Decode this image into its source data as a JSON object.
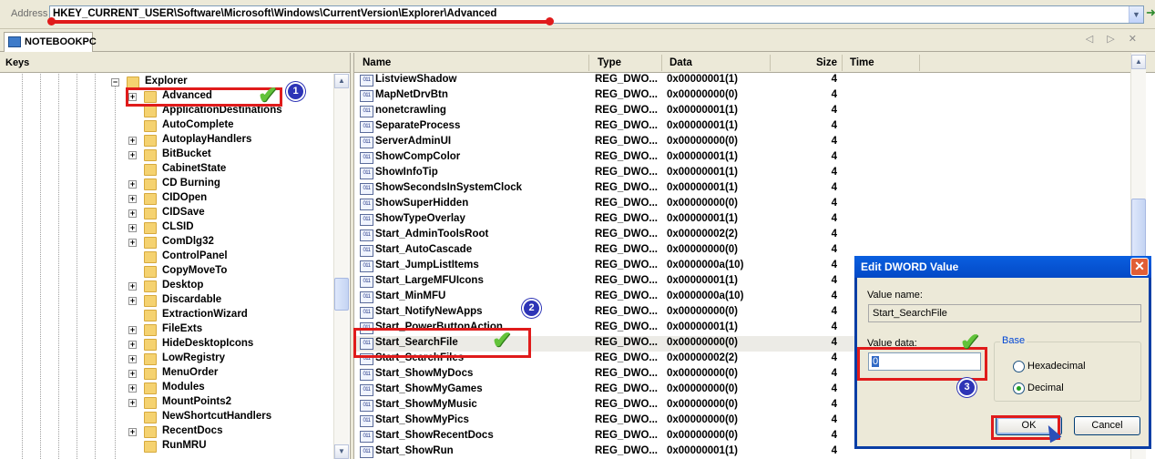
{
  "address": {
    "label": "Address",
    "value": "HKEY_CURRENT_USER\\Software\\Microsoft\\Windows\\CurrentVersion\\Explorer\\Advanced"
  },
  "tab": {
    "label": "NOTEBOOKPC",
    "controls": "◁ ▷ ✕"
  },
  "keys_pane": {
    "title": "Keys",
    "items": [
      {
        "label": "Explorer",
        "level": 0,
        "expander": "−"
      },
      {
        "label": "Advanced",
        "level": 1,
        "expander": "+"
      },
      {
        "label": "ApplicationDestinations",
        "level": 1,
        "expander": ""
      },
      {
        "label": "AutoComplete",
        "level": 1,
        "expander": ""
      },
      {
        "label": "AutoplayHandlers",
        "level": 1,
        "expander": "+"
      },
      {
        "label": "BitBucket",
        "level": 1,
        "expander": "+"
      },
      {
        "label": "CabinetState",
        "level": 1,
        "expander": ""
      },
      {
        "label": "CD Burning",
        "level": 1,
        "expander": "+"
      },
      {
        "label": "CIDOpen",
        "level": 1,
        "expander": "+"
      },
      {
        "label": "CIDSave",
        "level": 1,
        "expander": "+"
      },
      {
        "label": "CLSID",
        "level": 1,
        "expander": "+"
      },
      {
        "label": "ComDlg32",
        "level": 1,
        "expander": "+"
      },
      {
        "label": "ControlPanel",
        "level": 1,
        "expander": ""
      },
      {
        "label": "CopyMoveTo",
        "level": 1,
        "expander": ""
      },
      {
        "label": "Desktop",
        "level": 1,
        "expander": "+"
      },
      {
        "label": "Discardable",
        "level": 1,
        "expander": "+"
      },
      {
        "label": "ExtractionWizard",
        "level": 1,
        "expander": ""
      },
      {
        "label": "FileExts",
        "level": 1,
        "expander": "+"
      },
      {
        "label": "HideDesktopIcons",
        "level": 1,
        "expander": "+"
      },
      {
        "label": "LowRegistry",
        "level": 1,
        "expander": "+"
      },
      {
        "label": "MenuOrder",
        "level": 1,
        "expander": "+"
      },
      {
        "label": "Modules",
        "level": 1,
        "expander": "+"
      },
      {
        "label": "MountPoints2",
        "level": 1,
        "expander": "+"
      },
      {
        "label": "NewShortcutHandlers",
        "level": 1,
        "expander": ""
      },
      {
        "label": "RecentDocs",
        "level": 1,
        "expander": "+"
      },
      {
        "label": "RunMRU",
        "level": 1,
        "expander": ""
      }
    ]
  },
  "values_pane": {
    "columns": {
      "name": "Name",
      "type": "Type",
      "data": "Data",
      "size": "Size",
      "time": "Time"
    },
    "icon_text": "011",
    "rows": [
      {
        "name": "ListviewShadow",
        "type": "REG_DWO...",
        "data": "0x00000001(1)",
        "size": "4"
      },
      {
        "name": "MapNetDrvBtn",
        "type": "REG_DWO...",
        "data": "0x00000000(0)",
        "size": "4"
      },
      {
        "name": "nonetcrawling",
        "type": "REG_DWO...",
        "data": "0x00000001(1)",
        "size": "4"
      },
      {
        "name": "SeparateProcess",
        "type": "REG_DWO...",
        "data": "0x00000001(1)",
        "size": "4"
      },
      {
        "name": "ServerAdminUI",
        "type": "REG_DWO...",
        "data": "0x00000000(0)",
        "size": "4"
      },
      {
        "name": "ShowCompColor",
        "type": "REG_DWO...",
        "data": "0x00000001(1)",
        "size": "4"
      },
      {
        "name": "ShowInfoTip",
        "type": "REG_DWO...",
        "data": "0x00000001(1)",
        "size": "4"
      },
      {
        "name": "ShowSecondsInSystemClock",
        "type": "REG_DWO...",
        "data": "0x00000001(1)",
        "size": "4"
      },
      {
        "name": "ShowSuperHidden",
        "type": "REG_DWO...",
        "data": "0x00000000(0)",
        "size": "4"
      },
      {
        "name": "ShowTypeOverlay",
        "type": "REG_DWO...",
        "data": "0x00000001(1)",
        "size": "4"
      },
      {
        "name": "Start_AdminToolsRoot",
        "type": "REG_DWO...",
        "data": "0x00000002(2)",
        "size": "4"
      },
      {
        "name": "Start_AutoCascade",
        "type": "REG_DWO...",
        "data": "0x00000000(0)",
        "size": "4"
      },
      {
        "name": "Start_JumpListItems",
        "type": "REG_DWO...",
        "data": "0x0000000a(10)",
        "size": "4"
      },
      {
        "name": "Start_LargeMFUIcons",
        "type": "REG_DWO...",
        "data": "0x00000001(1)",
        "size": "4"
      },
      {
        "name": "Start_MinMFU",
        "type": "REG_DWO...",
        "data": "0x0000000a(10)",
        "size": "4"
      },
      {
        "name": "Start_NotifyNewApps",
        "type": "REG_DWO...",
        "data": "0x00000000(0)",
        "size": "4"
      },
      {
        "name": "Start_PowerButtonAction",
        "type": "REG_DWO...",
        "data": "0x00000001(1)",
        "size": "4"
      },
      {
        "name": "Start_SearchFile",
        "type": "REG_DWO...",
        "data": "0x00000000(0)",
        "size": "4"
      },
      {
        "name": "Start_SearchFiles",
        "type": "REG_DWO...",
        "data": "0x00000002(2)",
        "size": "4"
      },
      {
        "name": "Start_ShowMyDocs",
        "type": "REG_DWO...",
        "data": "0x00000000(0)",
        "size": "4"
      },
      {
        "name": "Start_ShowMyGames",
        "type": "REG_DWO...",
        "data": "0x00000000(0)",
        "size": "4"
      },
      {
        "name": "Start_ShowMyMusic",
        "type": "REG_DWO...",
        "data": "0x00000000(0)",
        "size": "4"
      },
      {
        "name": "Start_ShowMyPics",
        "type": "REG_DWO...",
        "data": "0x00000000(0)",
        "size": "4"
      },
      {
        "name": "Start_ShowRecentDocs",
        "type": "REG_DWO...",
        "data": "0x00000000(0)",
        "size": "4"
      },
      {
        "name": "Start_ShowRun",
        "type": "REG_DWO...",
        "data": "0x00000001(1)",
        "size": "4"
      }
    ]
  },
  "dialog": {
    "title": "Edit DWORD Value",
    "close": "✕",
    "value_name_label": "Value name:",
    "value_name": "Start_SearchFile",
    "value_data_label": "Value data:",
    "value_data": "0",
    "base_label": "Base",
    "hex_label": "Hexadecimal",
    "dec_label": "Decimal",
    "selected_base": "Decimal",
    "ok": "OK",
    "cancel": "Cancel"
  },
  "annotations": {
    "badge1": "1",
    "badge2": "2",
    "badge3": "3",
    "accent": "#e01b1b",
    "badge_color": "#2d34b6"
  }
}
